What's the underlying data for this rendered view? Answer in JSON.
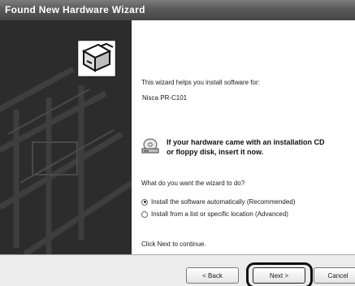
{
  "window": {
    "title": "Found New Hardware Wizard"
  },
  "icons": {
    "hardware": "hardware-install-icon",
    "cd": "cd-drive-icon"
  },
  "content": {
    "intro": "This wizard helps you install software for:",
    "device": "Nisca PR-C101",
    "cd_line1": "If your hardware came with an installation CD",
    "cd_line2": "or floppy disk, insert it now.",
    "question": "What do you want the wizard to do?",
    "options": [
      {
        "label": "Install the software automatically (Recommended)",
        "selected": true
      },
      {
        "label": "Install from a list or specific location (Advanced)",
        "selected": false
      }
    ],
    "continue": "Click Next to continue."
  },
  "buttons": {
    "back": "< Back",
    "next": "Next >",
    "cancel": "Cancel"
  }
}
